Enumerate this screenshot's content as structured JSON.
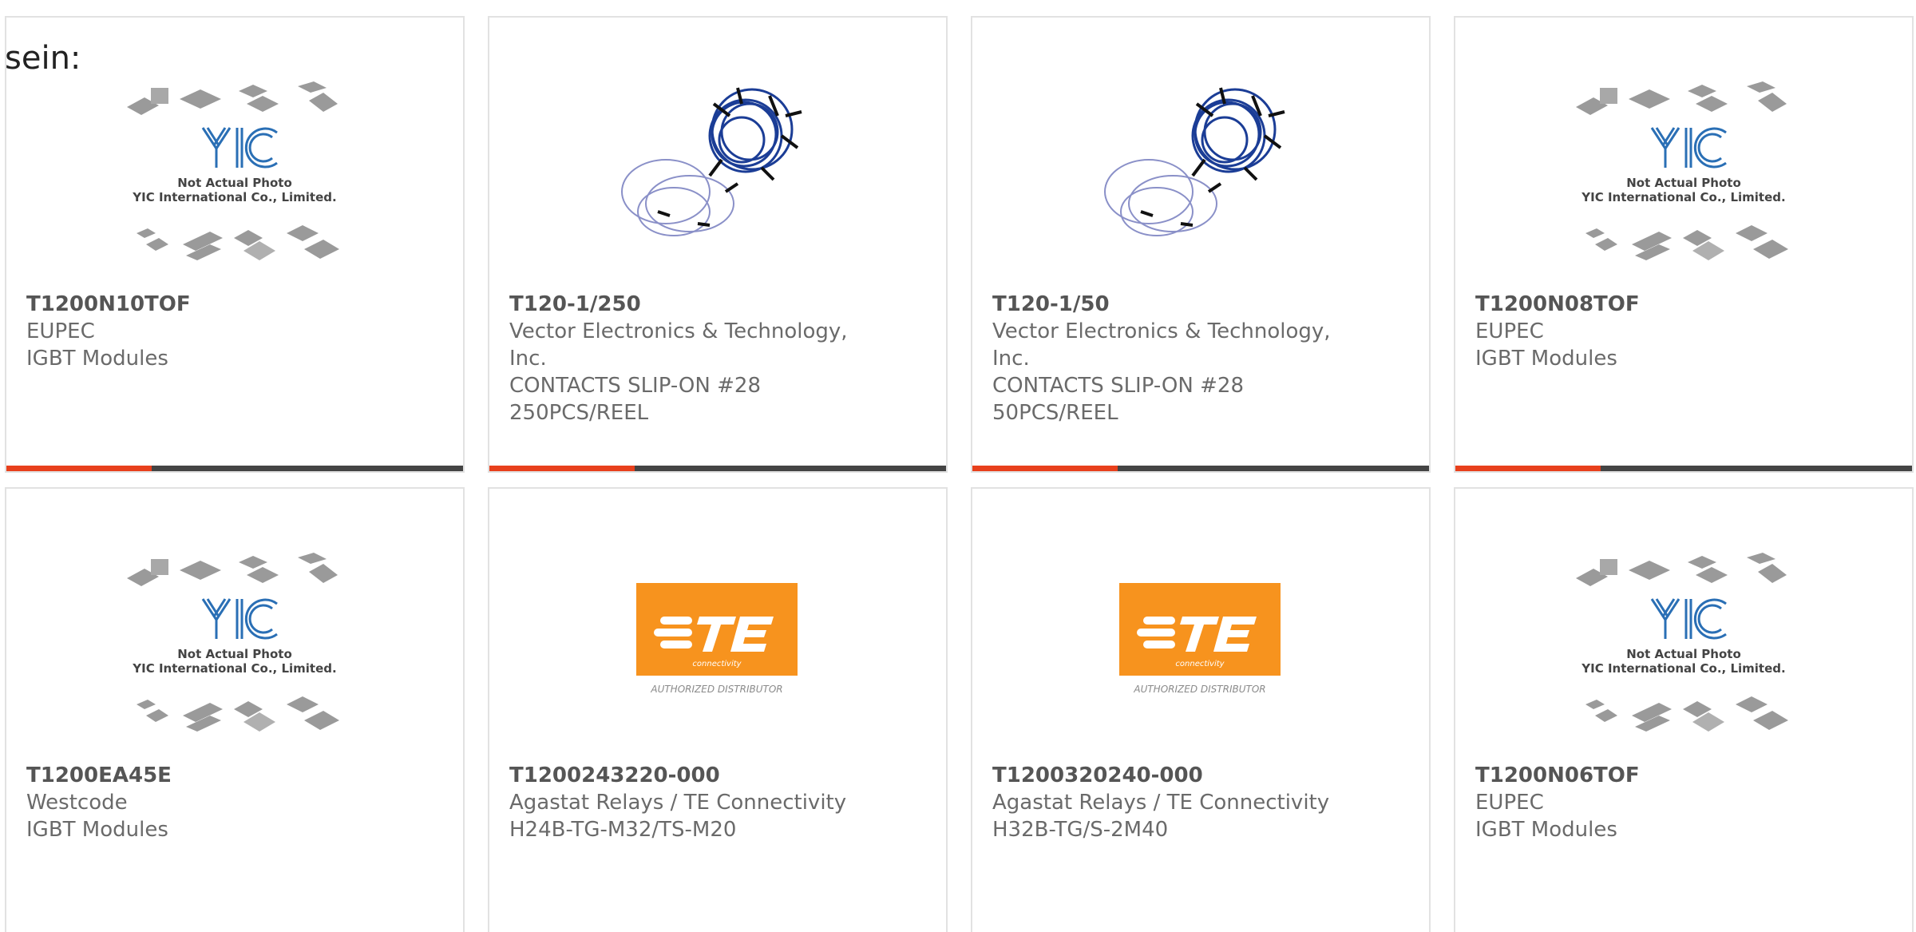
{
  "lead_text": "sein:",
  "colors": {
    "accent": "#e8401c",
    "bar": "#444444",
    "te_orange": "#f7931e"
  },
  "products": [
    {
      "part": "T1200N10TOF",
      "lines": [
        "EUPEC",
        "IGBT Modules"
      ],
      "image": "yic-placeholder",
      "placeholder": {
        "line1": "Not Actual Photo",
        "line2": "YIC International Co., Limited."
      }
    },
    {
      "part": "T120-1/250",
      "lines": [
        "Vector Electronics & Technology,",
        "Inc.",
        "CONTACTS SLIP-ON #28",
        "250PCS/REEL"
      ],
      "image": "wire-contacts"
    },
    {
      "part": "T120-1/50",
      "lines": [
        "Vector Electronics & Technology,",
        "Inc.",
        "CONTACTS SLIP-ON #28",
        "50PCS/REEL"
      ],
      "image": "wire-contacts"
    },
    {
      "part": "T1200N08TOF",
      "lines": [
        "EUPEC",
        "IGBT Modules"
      ],
      "image": "yic-placeholder",
      "placeholder": {
        "line1": "Not Actual Photo",
        "line2": "YIC International Co., Limited."
      }
    },
    {
      "part": "T1200EA45E",
      "lines": [
        "Westcode",
        "IGBT Modules"
      ],
      "image": "yic-placeholder",
      "placeholder": {
        "line1": "Not Actual Photo",
        "line2": "YIC International Co., Limited."
      }
    },
    {
      "part": "T1200243220-000",
      "lines": [
        "Agastat Relays / TE Connectivity",
        "H24B-TG-M32/TS-M20"
      ],
      "image": "te-logo",
      "logo_caption": "AUTHORIZED DISTRIBUTOR"
    },
    {
      "part": "T1200320240-000",
      "lines": [
        "Agastat Relays / TE Connectivity",
        "H32B-TG/S-2M40"
      ],
      "image": "te-logo",
      "logo_caption": "AUTHORIZED DISTRIBUTOR"
    },
    {
      "part": "T1200N06TOF",
      "lines": [
        "EUPEC",
        "IGBT Modules"
      ],
      "image": "yic-placeholder",
      "placeholder": {
        "line1": "Not Actual Photo",
        "line2": "YIC International Co., Limited."
      }
    }
  ]
}
